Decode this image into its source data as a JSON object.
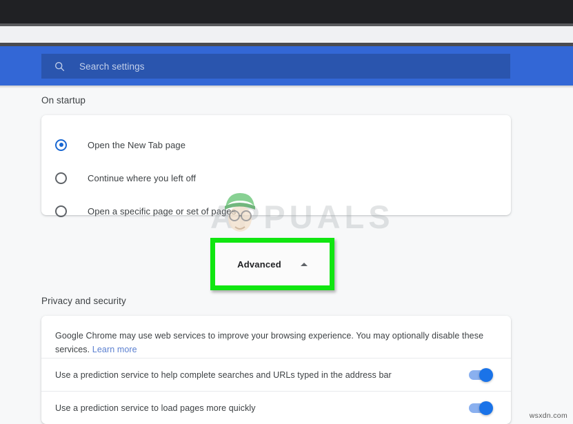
{
  "browser": {
    "top_bar_color": "#202124",
    "band_color": "#3367d6"
  },
  "search": {
    "icon": "search-icon",
    "placeholder": "Search settings",
    "value": ""
  },
  "sections": {
    "on_startup": {
      "title": "On startup",
      "options": [
        {
          "label": "Open the New Tab page",
          "selected": true
        },
        {
          "label": "Continue where you left off",
          "selected": false
        },
        {
          "label": "Open a specific page or set of pages",
          "selected": false
        }
      ]
    },
    "advanced": {
      "label": "Advanced",
      "chevron": "chevron-up-icon",
      "expanded": true,
      "highlight_color": "#10e610"
    },
    "privacy": {
      "title": "Privacy and security",
      "description": "Google Chrome may use web services to improve your browsing experience. You may optionally disable these services.",
      "link_label": "Learn more",
      "link_color": "#5a7fd0",
      "toggles": [
        {
          "label": "Use a prediction service to help complete searches and URLs typed in the address bar",
          "on": true
        },
        {
          "label": "Use a prediction service to load pages more quickly",
          "on": true
        }
      ]
    }
  },
  "watermarks": {
    "center": "APPUALS",
    "corner": "wsxdn.com"
  }
}
